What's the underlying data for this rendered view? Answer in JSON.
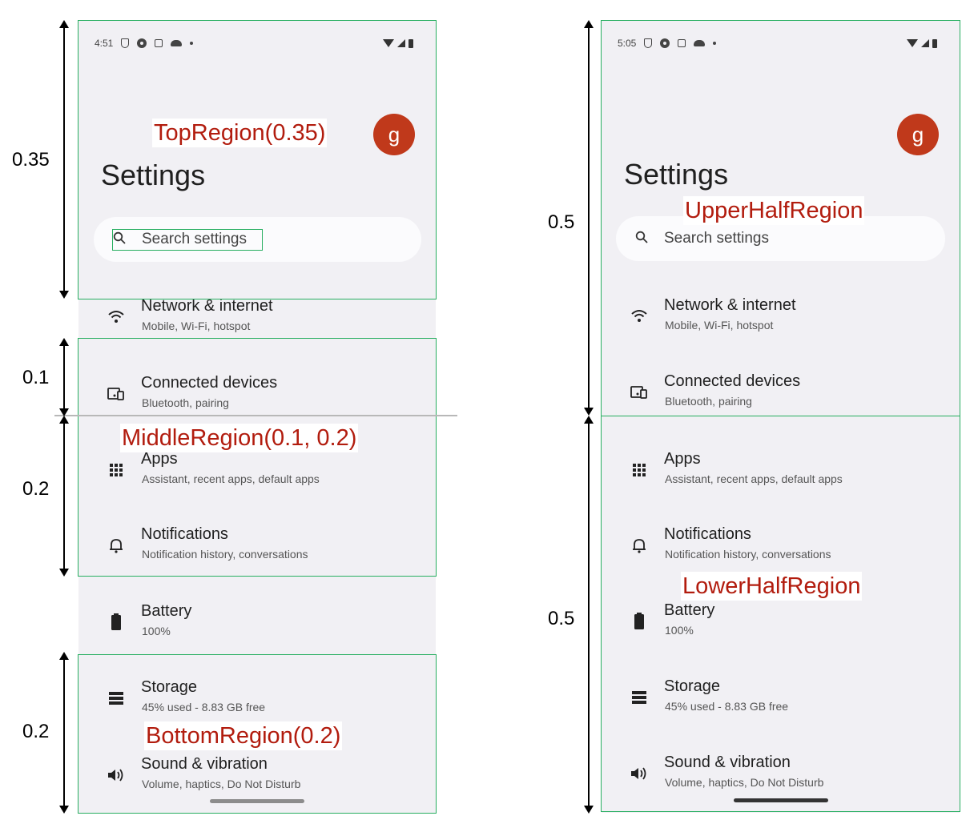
{
  "phones": [
    {
      "time": "4:51",
      "avatar_letter": "g",
      "title": "Settings",
      "search_placeholder": "Search settings",
      "items": [
        {
          "label": "Network & internet",
          "sub": "Mobile, Wi-Fi, hotspot",
          "icon": "wifi-icon"
        },
        {
          "label": "Connected devices",
          "sub": "Bluetooth, pairing",
          "icon": "devices-icon"
        },
        {
          "label": "Apps",
          "sub": "Assistant, recent apps, default apps",
          "icon": "apps-grid-icon"
        },
        {
          "label": "Notifications",
          "sub": "Notification history, conversations",
          "icon": "bell-icon"
        },
        {
          "label": "Battery",
          "sub": "100%",
          "icon": "battery-icon"
        },
        {
          "label": "Storage",
          "sub": "45% used - 8.83 GB free",
          "icon": "storage-icon"
        },
        {
          "label": "Sound & vibration",
          "sub": "Volume, haptics, Do Not Disturb",
          "icon": "speaker-icon"
        }
      ]
    },
    {
      "time": "5:05",
      "avatar_letter": "g",
      "title": "Settings",
      "search_placeholder": "Search settings",
      "items": [
        {
          "label": "Network & internet",
          "sub": "Mobile, Wi-Fi, hotspot",
          "icon": "wifi-icon"
        },
        {
          "label": "Connected devices",
          "sub": "Bluetooth, pairing",
          "icon": "devices-icon"
        },
        {
          "label": "Apps",
          "sub": "Assistant, recent apps, default apps",
          "icon": "apps-grid-icon"
        },
        {
          "label": "Notifications",
          "sub": "Notification history, conversations",
          "icon": "bell-icon"
        },
        {
          "label": "Battery",
          "sub": "100%",
          "icon": "battery-icon"
        },
        {
          "label": "Storage",
          "sub": "45% used - 8.83 GB free",
          "icon": "storage-icon"
        },
        {
          "label": "Sound & vibration",
          "sub": "Volume, haptics, Do Not Disturb",
          "icon": "speaker-icon"
        }
      ]
    }
  ],
  "annotations": {
    "left": {
      "regions": [
        {
          "label": "TopRegion(0.35)",
          "fraction": "0.35"
        },
        {
          "label": "MiddleRegion(0.1, 0.2)",
          "fractions": [
            "0.1",
            "0.2"
          ]
        },
        {
          "label": "BottomRegion(0.2)",
          "fraction": "0.2"
        }
      ]
    },
    "right": {
      "regions": [
        {
          "label": "UpperHalfRegion",
          "fraction": "0.5"
        },
        {
          "label": "LowerHalfRegion",
          "fraction": "0.5"
        }
      ]
    }
  },
  "colors": {
    "region_border": "#27ae60",
    "region_label": "#b21c0e",
    "avatar": "#c0391b",
    "screen_bg": "#f1f0f4"
  }
}
